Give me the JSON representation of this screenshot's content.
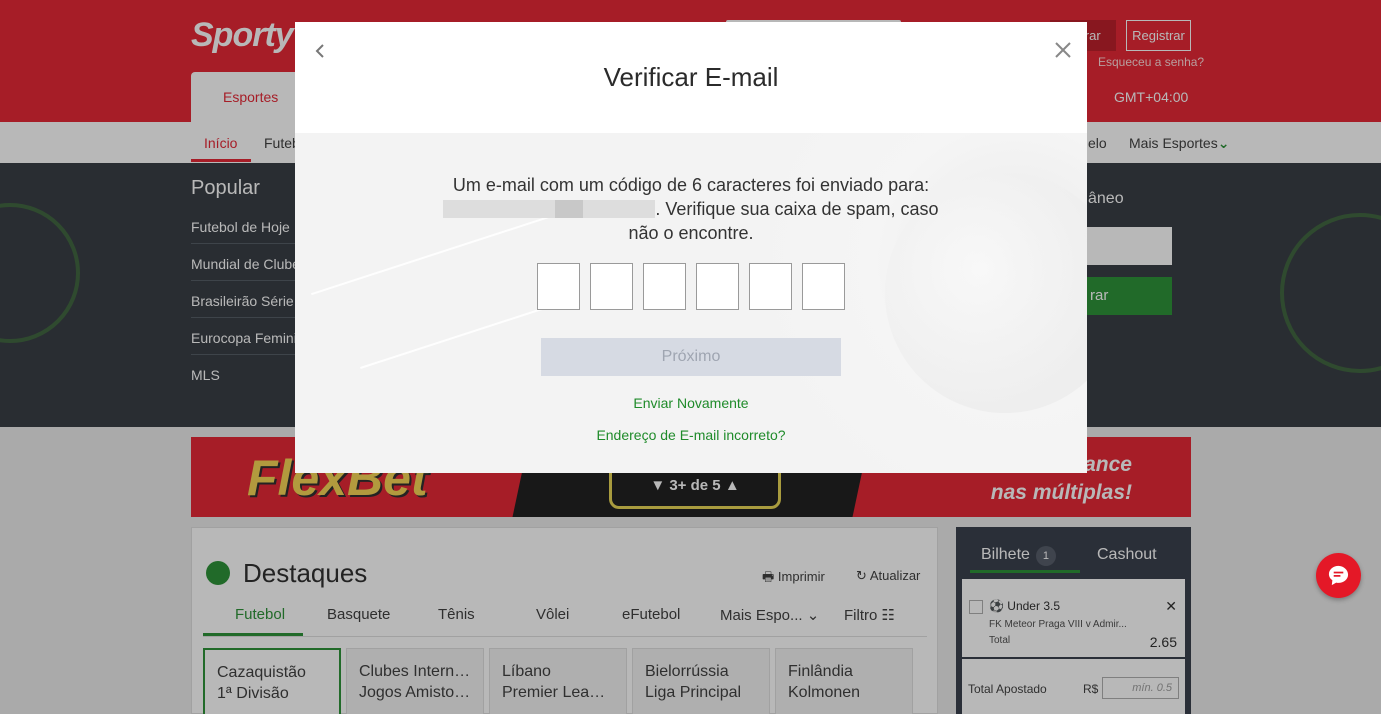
{
  "header": {
    "logo": "Sporty",
    "sports_tab": "Esportes",
    "login_label": "Entrar",
    "register_label": "Registrar",
    "forgot_password": "Esqueceu a senha?",
    "timezone": "GMT+04:00"
  },
  "nav": {
    "items": [
      "Início",
      "Futebol",
      "Mais Esportes"
    ],
    "partial_item": "elo"
  },
  "popular": {
    "title": "Popular",
    "items": [
      "Futebol de Hoje",
      "Mundial de Clubes",
      "Brasileirão Série A",
      "Eurocopa Feminina",
      "MLS"
    ]
  },
  "side_panel": {
    "title": "âneo",
    "button": "rar"
  },
  "banner": {
    "logo_text": "FlexBet",
    "mid_text": "3+ de 5",
    "right_text_line1": "ance",
    "right_text_line2": "nas múltiplas!"
  },
  "highlights": {
    "title": "Destaques",
    "print_label": "Imprimir",
    "refresh_label": "Atualizar",
    "tabs": [
      "Futebol",
      "Basquete",
      "Tênis",
      "Vôlei",
      "eFutebol",
      "Mais Espo...",
      "Filtro"
    ],
    "leagues": [
      {
        "line1": "Cazaquistão",
        "line2": "1ª Divisão"
      },
      {
        "line1": "Clubes Interna...",
        "line2": "Jogos Amistos..."
      },
      {
        "line1": "Líbano",
        "line2": "Premier League"
      },
      {
        "line1": "Bielorrússia",
        "line2": "Liga Principal"
      },
      {
        "line1": "Finlândia",
        "line2": "Kolmonen"
      }
    ]
  },
  "betslip": {
    "tab_ticket": "Bilhete",
    "ticket_count": "1",
    "tab_cashout": "Cashout",
    "selection": "Under 3.5",
    "match": "FK Meteor Praga VIII v Admir...",
    "total_label": "Total",
    "odd": "2.65",
    "stake_label": "Total Apostado",
    "currency": "R$",
    "stake_placeholder": "mín. 0.5"
  },
  "modal": {
    "title": "Verificar E-mail",
    "message_part1": "Um e-mail com um código de 6 caracteres foi enviado para:",
    "message_part2": ". Verifique sua caixa de spam, caso não o encontre.",
    "code_digits": [
      "",
      "",
      "",
      "",
      "",
      ""
    ],
    "next_button": "Próximo",
    "resend_link": "Enviar Novamente",
    "wrong_email_link": "Endereço de E-mail incorreto?"
  },
  "colors": {
    "brand_red": "#e41827",
    "accent_green": "#1f8b2a",
    "disabled_button": "#d6dae3"
  }
}
